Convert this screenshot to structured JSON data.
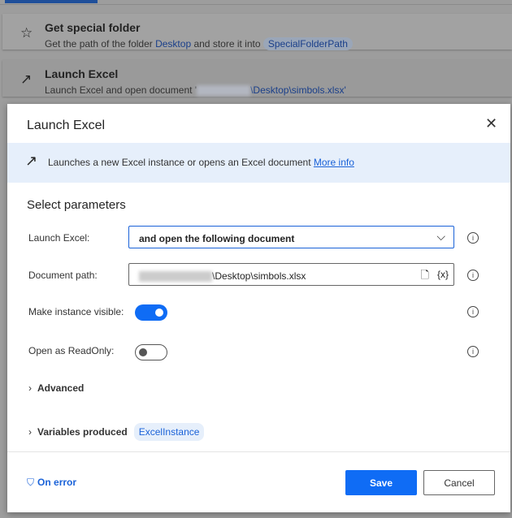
{
  "background_actions": [
    {
      "icon": "star-icon",
      "title": "Get special folder",
      "desc_prefix": "Get the path of the folder ",
      "folder": "Desktop",
      "desc_mid": " and store it into ",
      "variable": "SpecialFolderPath"
    },
    {
      "icon": "arrow-up-right-icon",
      "title": "Launch Excel",
      "desc_prefix": "Launch Excel and open document '",
      "path_suffix": "\\Desktop\\simbols.xlsx'"
    }
  ],
  "dialog": {
    "title": "Launch Excel",
    "info_text": "Launches a new Excel instance or opens an Excel document ",
    "more_info": "More info",
    "section": "Select parameters",
    "launch_label": "Launch Excel:",
    "launch_value": "and open the following document",
    "path_label": "Document path:",
    "path_value": "\\Desktop\\simbols.xlsx",
    "visible_label": "Make instance visible:",
    "visible_on": true,
    "readonly_label": "Open as ReadOnly:",
    "readonly_on": false,
    "advanced": "Advanced",
    "vars_label": "Variables produced",
    "var_name": "ExcelInstance",
    "on_error": "On error",
    "save": "Save",
    "cancel": "Cancel",
    "accent": "#0f6cf5"
  }
}
